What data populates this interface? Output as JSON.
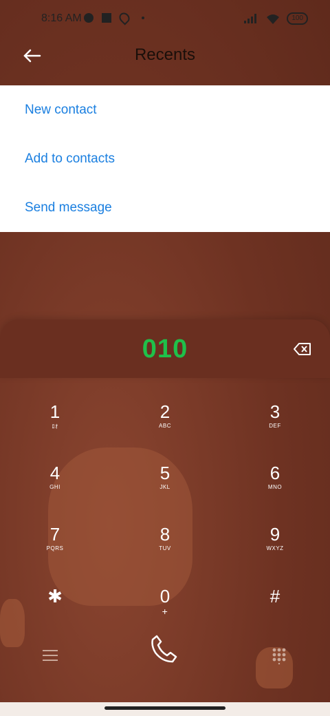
{
  "status_bar": {
    "time": "8:16 AM",
    "battery": "100"
  },
  "header": {
    "title": "Recents"
  },
  "menu": {
    "items": [
      "New contact",
      "Add to contacts",
      "Send message"
    ]
  },
  "dialer": {
    "number": "010",
    "keys": [
      {
        "digit": "1",
        "letters": "ﾛｵ"
      },
      {
        "digit": "2",
        "letters": "ABC"
      },
      {
        "digit": "3",
        "letters": "DEF"
      },
      {
        "digit": "4",
        "letters": "GHI"
      },
      {
        "digit": "5",
        "letters": "JKL"
      },
      {
        "digit": "6",
        "letters": "MNO"
      },
      {
        "digit": "7",
        "letters": "PQRS"
      },
      {
        "digit": "8",
        "letters": "TUV"
      },
      {
        "digit": "9",
        "letters": "WXYZ"
      },
      {
        "digit": "✱",
        "letters": ""
      },
      {
        "digit": "0",
        "letters": "+"
      },
      {
        "digit": "#",
        "letters": ""
      }
    ]
  },
  "bottom": {
    "icons": [
      "menu-icon",
      "call-icon",
      "dialpad-icon"
    ]
  },
  "colors": {
    "accent": "#1a7fe0",
    "dialed": "#1fc04a",
    "background": "#6e3222"
  }
}
